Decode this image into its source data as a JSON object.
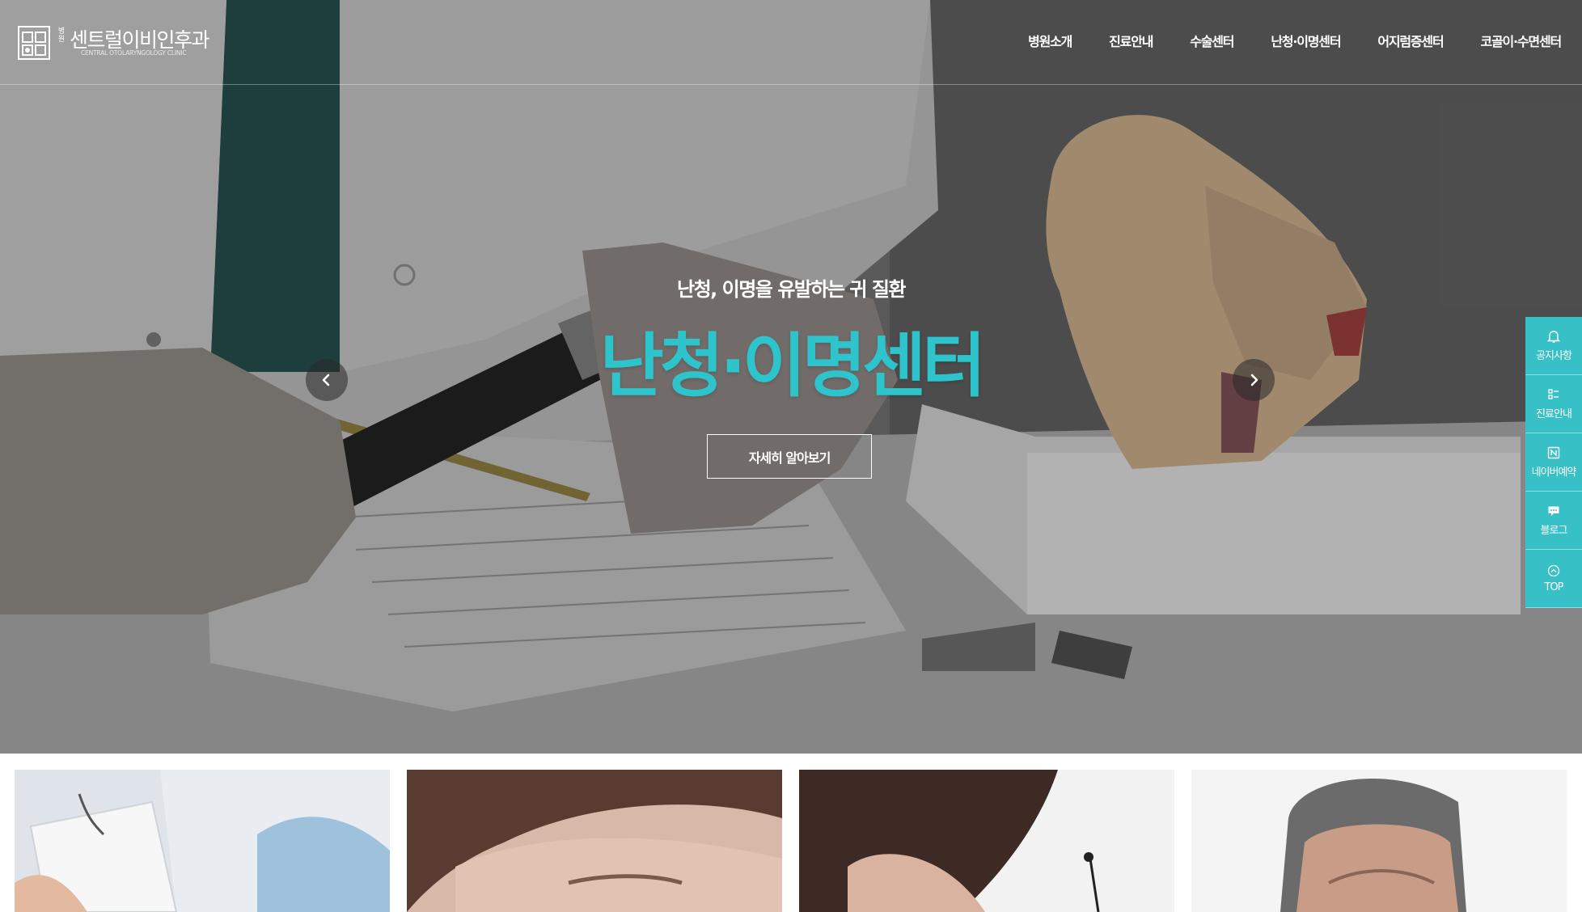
{
  "header": {
    "logo_tag": "병원",
    "logo_name": "센트럴이비인후과",
    "logo_sub": "CENTRAL OTOLARYNGOLOGY CLINIC",
    "nav": [
      "병원소개",
      "진료안내",
      "수술센터",
      "난청·이명센터",
      "어지럼증센터",
      "코골이·수면센터"
    ]
  },
  "hero": {
    "subtitle": "난청, 이명을 유발하는 귀 질환",
    "title": "난청·이명센터",
    "button_label": "자세히 알아보기",
    "prev_icon": "chevron-left-icon",
    "next_icon": "chevron-right-icon"
  },
  "quick_menu": [
    {
      "label": "공지사항",
      "icon": "bell-icon"
    },
    {
      "label": "진료안내",
      "icon": "list-icon"
    },
    {
      "label": "네이버예약",
      "icon": "naver-icon"
    },
    {
      "label": "블로그",
      "icon": "chat-bubble-icon"
    },
    {
      "label": "TOP",
      "icon": "arrow-up-circle-icon"
    }
  ],
  "colors": {
    "accent": "#2ec4cc",
    "quick_menu_bg": "#37c0c6",
    "text_light": "#ffffff"
  }
}
